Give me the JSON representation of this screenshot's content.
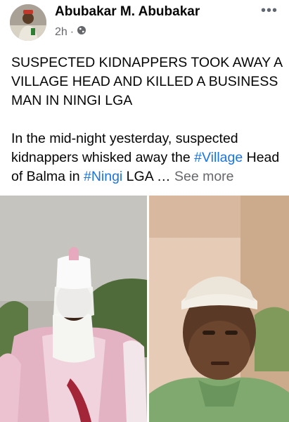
{
  "post": {
    "author": "Abubakar M. Abubakar",
    "time": "2h",
    "dot": "·",
    "audience_icon": "globe-icon",
    "more_label": "•••",
    "headline": "SUSPECTED KIDNAPPERS TOOK AWAY A VILLAGE HEAD AND KILLED A BUSINESS MAN IN NINGI LGA",
    "body_part1": "In the mid-night yesterday, suspected kidnappers whisked away the ",
    "hashtag1": "#Village",
    "body_part2": " Head of Balma in ",
    "hashtag2": "#Ningi",
    "body_part3": " LGA … ",
    "see_more": "See more"
  },
  "photos": [
    {
      "name": "photo-village-head"
    },
    {
      "name": "photo-business-man"
    }
  ]
}
